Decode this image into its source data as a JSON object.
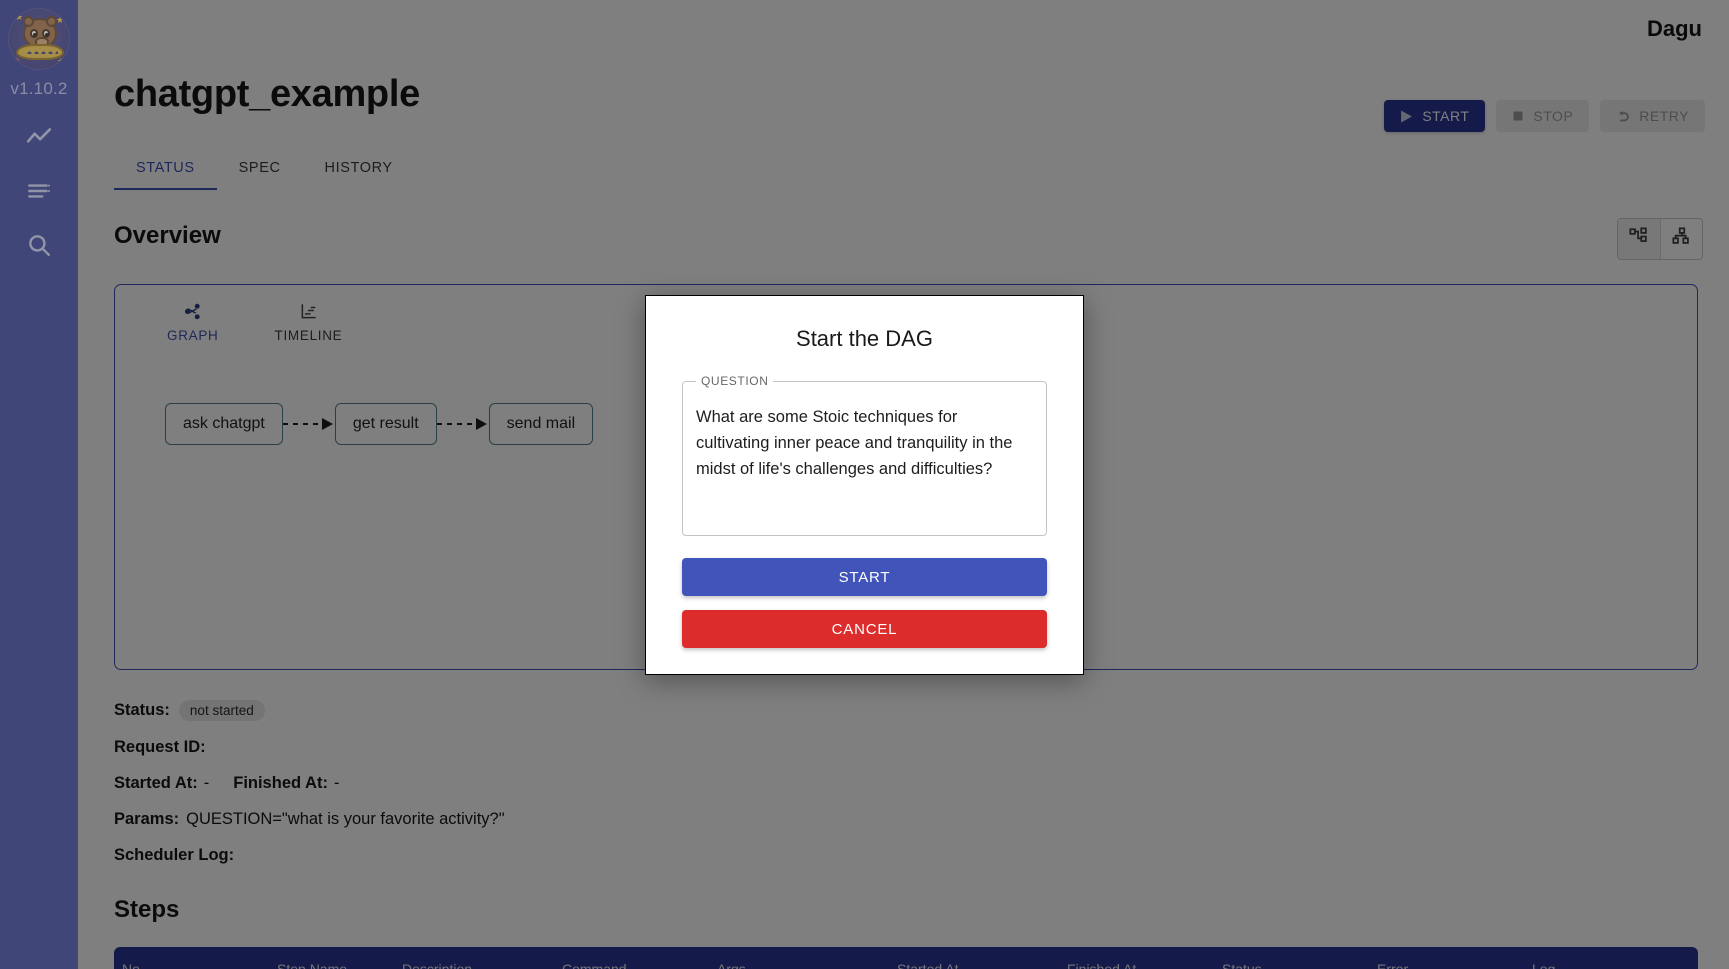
{
  "sidebar": {
    "logo_icon": "dagu-beaver-ufo-logo",
    "version": "v1.10.2",
    "items": [
      {
        "icon": "activity-chart-icon",
        "name": "dags-nav"
      },
      {
        "icon": "list-icon",
        "name": "search-dags-nav"
      },
      {
        "icon": "search-icon",
        "name": "search-nav"
      }
    ]
  },
  "header": {
    "brand": "Dagu",
    "page_title": "chatgpt_example",
    "actions": [
      {
        "label": "START",
        "icon": "play-icon",
        "style": "primary"
      },
      {
        "label": "STOP",
        "icon": "stop-square-icon",
        "style": "disabled"
      },
      {
        "label": "RETRY",
        "icon": "retry-arrow-icon",
        "style": "disabled"
      }
    ],
    "tabs": [
      {
        "label": "STATUS",
        "active": true
      },
      {
        "label": "SPEC",
        "active": false
      },
      {
        "label": "HISTORY",
        "active": false
      }
    ]
  },
  "overview": {
    "title": "Overview",
    "view_toggle": [
      {
        "icon": "graph-horizontal-icon",
        "selected": true
      },
      {
        "icon": "graph-vertical-icon",
        "selected": false
      }
    ],
    "graph_tabs": [
      {
        "label": "GRAPH",
        "icon": "share-nodes-icon",
        "active": true
      },
      {
        "label": "TIMELINE",
        "icon": "timeline-chart-icon",
        "active": false
      }
    ],
    "dag_nodes": [
      "ask chatgpt",
      "get result",
      "send mail"
    ]
  },
  "details": {
    "status_label": "Status:",
    "status_value": "not started",
    "request_id_label": "Request ID:",
    "request_id_value": "",
    "started_at_label": "Started At:",
    "started_at_value": "-",
    "finished_at_label": "Finished At:",
    "finished_at_value": "-",
    "params_label": "Params:",
    "params_value": "QUESTION=\"what is your favorite activity?\"",
    "scheduler_log_label": "Scheduler Log:",
    "scheduler_log_value": ""
  },
  "steps": {
    "title": "Steps",
    "columns": [
      "No",
      "Step Name",
      "Description",
      "Command",
      "Args",
      "Started At",
      "Finished At",
      "Status",
      "Error",
      "Log"
    ]
  },
  "modal": {
    "title": "Start the DAG",
    "field_label": "QUESTION",
    "field_value": "What are some Stoic techniques for cultivating inner peace and tranquility in the midst of life's challenges and difficulties?",
    "field_placeholder": "",
    "start_label": "START",
    "cancel_label": "CANCEL",
    "colors": {
      "start": "#4154b9",
      "cancel": "#dd2c2c"
    }
  },
  "colors": {
    "sidebar": "#2f3a8c",
    "primary": "#283593",
    "accent": "#3f51b5",
    "node_border": "#55808c"
  }
}
